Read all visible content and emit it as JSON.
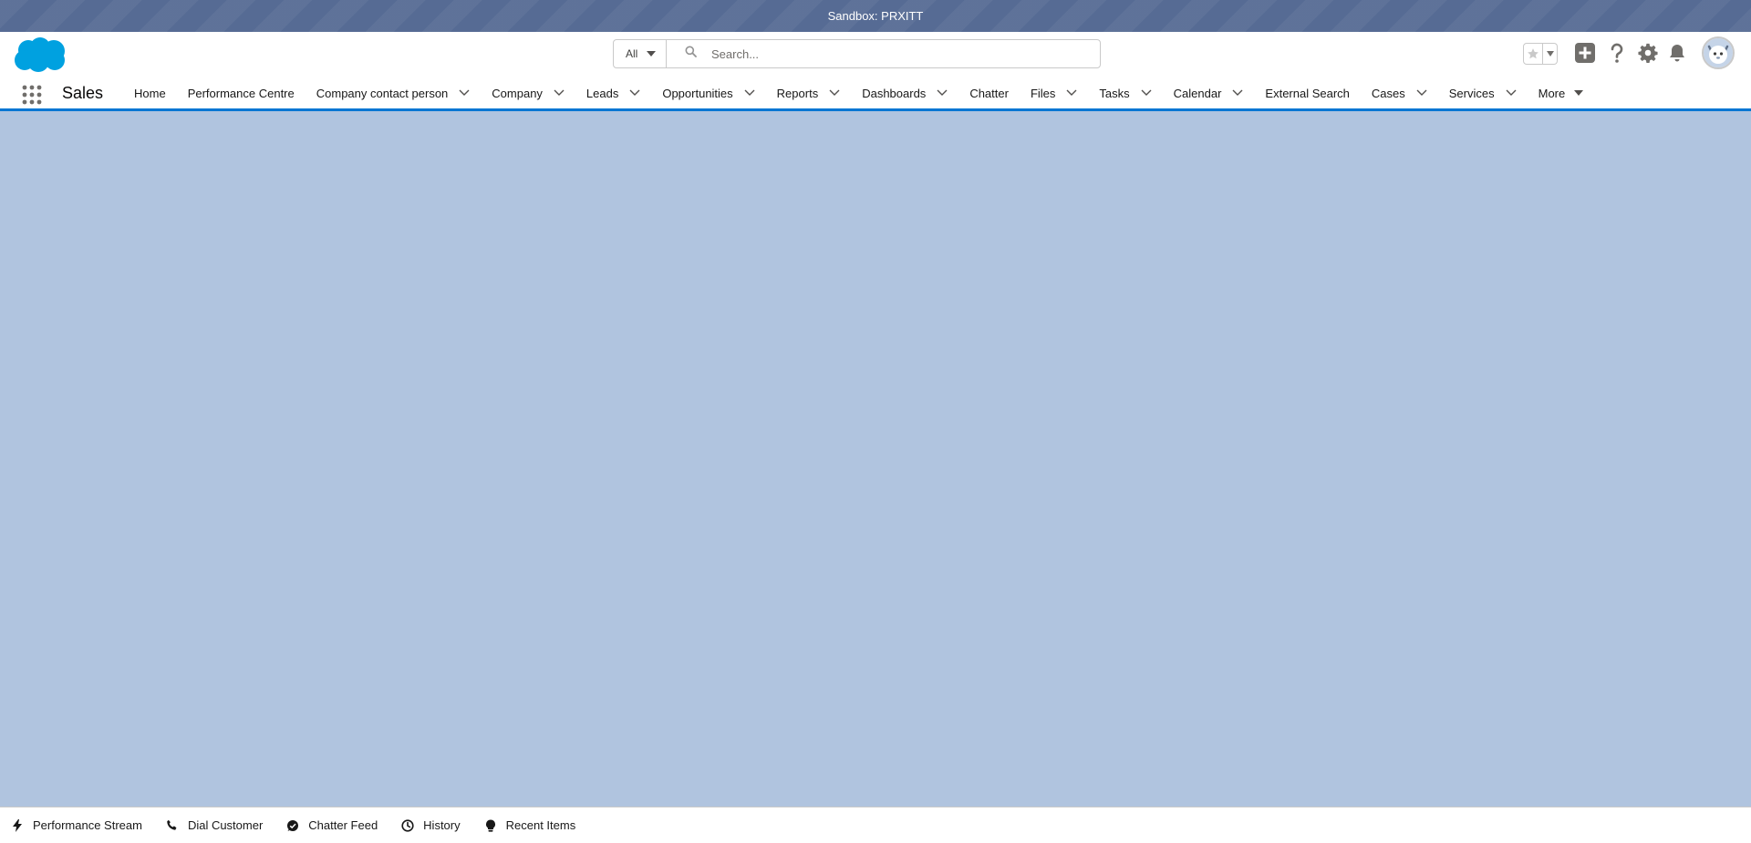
{
  "sandbox": {
    "label": "Sandbox: PRXITT"
  },
  "header": {
    "logo_icon": "salesforce-cloud-logo",
    "search": {
      "scope": "All",
      "placeholder": "Search..."
    },
    "icons": [
      "favorites-star-icon",
      "favorites-menu-icon",
      "global-add-icon",
      "help-icon",
      "setup-gear-icon",
      "notifications-bell-icon",
      "user-avatar"
    ]
  },
  "nav": {
    "app_name": "Sales",
    "items": [
      {
        "label": "Home",
        "dropdown": false
      },
      {
        "label": "Performance Centre",
        "dropdown": false
      },
      {
        "label": "Company contact person",
        "dropdown": true
      },
      {
        "label": "Company",
        "dropdown": true
      },
      {
        "label": "Leads",
        "dropdown": true
      },
      {
        "label": "Opportunities",
        "dropdown": true
      },
      {
        "label": "Reports",
        "dropdown": true
      },
      {
        "label": "Dashboards",
        "dropdown": true
      },
      {
        "label": "Chatter",
        "dropdown": false
      },
      {
        "label": "Files",
        "dropdown": true
      },
      {
        "label": "Tasks",
        "dropdown": true
      },
      {
        "label": "Calendar",
        "dropdown": true
      },
      {
        "label": "External Search",
        "dropdown": false
      },
      {
        "label": "Cases",
        "dropdown": true
      },
      {
        "label": "Services",
        "dropdown": true
      }
    ],
    "more_label": "More"
  },
  "utility_bar": {
    "items": [
      {
        "label": "Performance Stream",
        "icon": "bolt-icon"
      },
      {
        "label": "Dial Customer",
        "icon": "phone-icon"
      },
      {
        "label": "Chatter Feed",
        "icon": "chatter-icon"
      },
      {
        "label": "History",
        "icon": "clock-icon"
      },
      {
        "label": "Recent Items",
        "icon": "lightbulb-icon"
      }
    ]
  },
  "colors": {
    "sandbox_bar": "#566b94",
    "content_background": "#b0c4df",
    "brand_blue": "#0176d3",
    "logo_blue": "#00a1e0"
  }
}
